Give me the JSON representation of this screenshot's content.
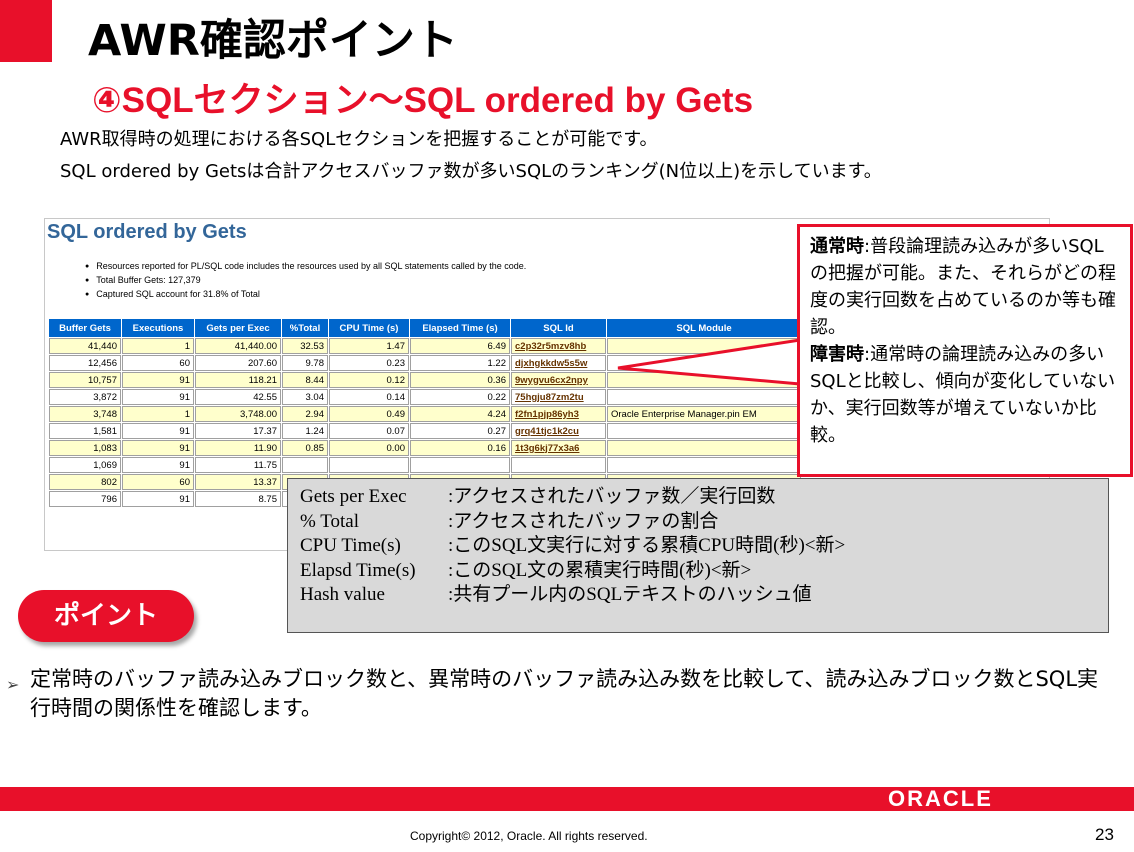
{
  "slide": {
    "title": "AWR確認ポイント",
    "subtitle": "④SQLセクション～SQL ordered by Gets",
    "intro_line1": "AWR取得時の処理における各SQLセクションを把握することが可能です。",
    "intro_line2": "SQL ordered by Getsは合計アクセスバッファ数が多いSQLのランキング(N位以上)を示しています。"
  },
  "report": {
    "title": "SQL ordered by Gets",
    "bullets": [
      "Resources reported for PL/SQL code includes the resources used by all SQL statements called by the code.",
      "Total Buffer Gets: 127,379",
      "Captured SQL account for 31.8% of Total"
    ],
    "columns": [
      "Buffer Gets",
      "Executions",
      "Gets per Exec",
      "%Total",
      "CPU Time (s)",
      "Elapsed Time (s)",
      "SQL Id",
      "SQL Module"
    ],
    "rows": [
      [
        "41,440",
        "1",
        "41,440.00",
        "32.53",
        "1.47",
        "6.49",
        "c2p32r5mzv8hb",
        ""
      ],
      [
        "12,456",
        "60",
        "207.60",
        "9.78",
        "0.23",
        "1.22",
        "djxhgkkdw5s5w",
        ""
      ],
      [
        "10,757",
        "91",
        "118.21",
        "8.44",
        "0.12",
        "0.36",
        "9wygvu6cx2npy",
        ""
      ],
      [
        "3,872",
        "91",
        "42.55",
        "3.04",
        "0.14",
        "0.22",
        "75hgju87zm2tu",
        ""
      ],
      [
        "3,748",
        "1",
        "3,748.00",
        "2.94",
        "0.49",
        "4.24",
        "f2fn1pjp86yh3",
        "Oracle Enterprise Manager.pin EM"
      ],
      [
        "1,581",
        "91",
        "17.37",
        "1.24",
        "0.07",
        "0.27",
        "grq41tjc1k2cu",
        ""
      ],
      [
        "1,083",
        "91",
        "11.90",
        "0.85",
        "0.00",
        "0.16",
        "1t3g6kj77x3a6",
        ""
      ],
      [
        "1,069",
        "91",
        "11.75",
        "",
        "",
        "",
        "",
        ""
      ],
      [
        "802",
        "60",
        "13.37",
        "",
        "",
        "",
        "",
        ""
      ],
      [
        "796",
        "91",
        "8.75",
        "",
        "",
        "",
        "",
        ""
      ]
    ]
  },
  "callout_normal": {
    "normal_label": "通常時",
    "normal_text": ":普段論理読み込みが多いSQLの把握が可能。また、それらがどの程度の実行回数を占めているのか等も確認。",
    "fault_label": "障害時",
    "fault_text": ":通常時の論理読み込みの多いSQLと比較し、傾向が変化していないか、実行回数等が増えていないか比較。"
  },
  "callout_defs": [
    {
      "term": "Gets per Exec",
      "desc": ":アクセスされたバッファ数／実行回数"
    },
    {
      "term": "% Total",
      "desc": ":アクセスされたバッファの割合"
    },
    {
      "term": "CPU Time(s)",
      "desc": ":このSQL文実行に対する累積CPU時間(秒)<新>"
    },
    {
      "term": "Elapsd Time(s)",
      "desc": ":このSQL文の累積実行時間(秒)<新>"
    },
    {
      "term": "Hash value",
      "desc": ":共有プール内のSQLテキストのハッシュ値"
    }
  ],
  "point": {
    "badge": "ポイント",
    "arrow": "➢",
    "text": "定常時のバッファ読み込みブロック数と、異常時のバッファ読み込み数を比較して、読み込みブロック数とSQL実行時間の関係性を確認します。"
  },
  "footer": {
    "logo": "ORACLE",
    "copyright": "Copyright© 2012, Oracle. All rights reserved.",
    "page": "23"
  },
  "colors": {
    "accent_red": "#e8102a",
    "table_header": "#0066cc",
    "row_highlight": "#ffffcc",
    "report_title": "#336699"
  }
}
